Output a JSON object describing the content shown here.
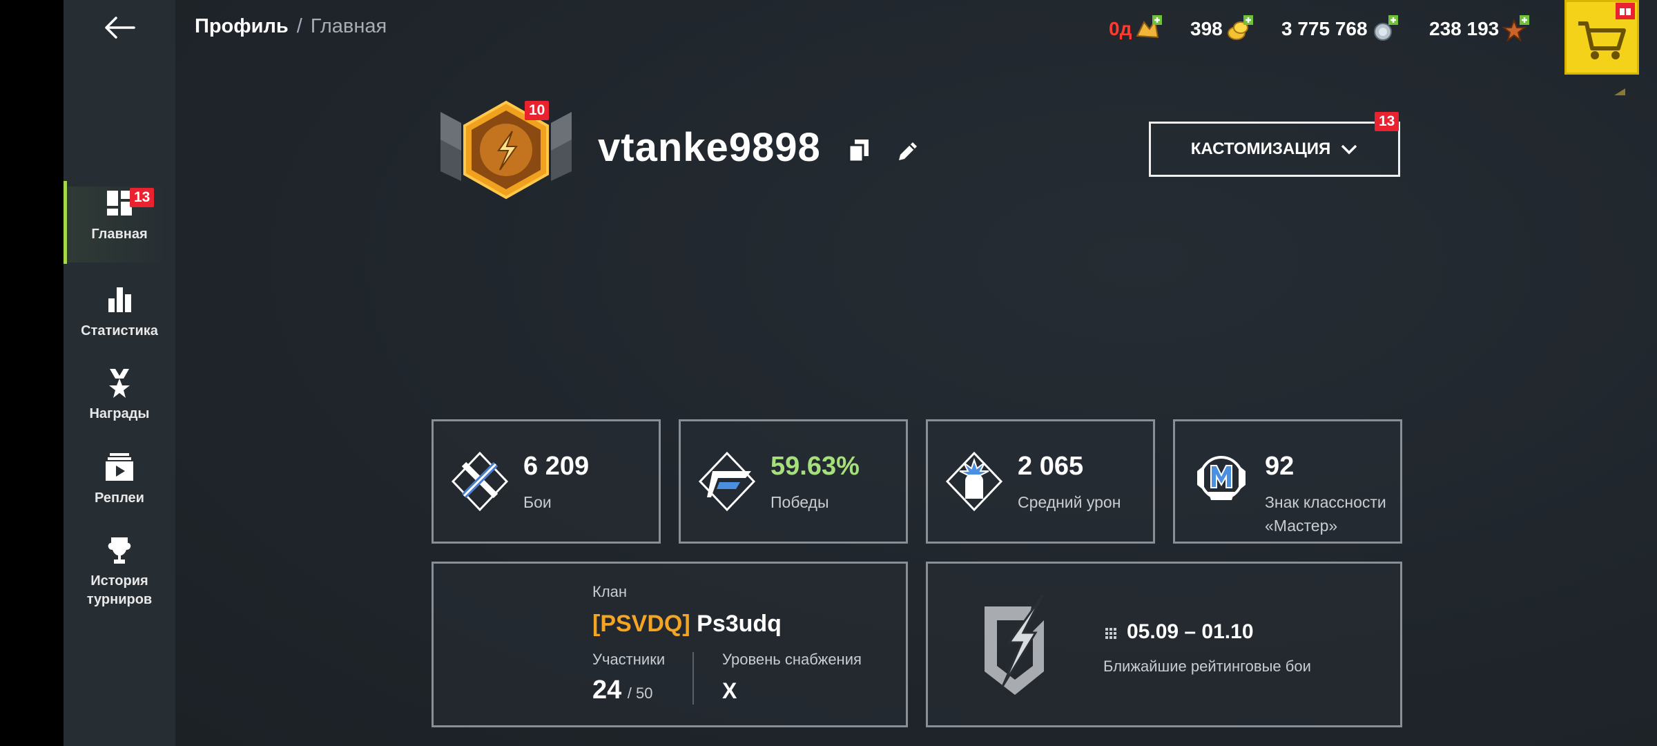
{
  "header": {
    "breadcrumb_primary": "Профиль",
    "breadcrumb_separator": "/",
    "breadcrumb_secondary": "Главная"
  },
  "currencies": [
    {
      "value": "0д",
      "icon": "premium-icon",
      "color": "#ff3b30"
    },
    {
      "value": "398",
      "icon": "gold-icon",
      "color": "#ffffff"
    },
    {
      "value": "3 775 768",
      "icon": "credits-icon",
      "color": "#ffffff"
    },
    {
      "value": "238 193",
      "icon": "free-xp-icon",
      "color": "#ffffff"
    }
  ],
  "sidebar": {
    "items": [
      {
        "label": "Главная",
        "icon": "dashboard-icon",
        "badge": "13",
        "active": true
      },
      {
        "label": "Статистика",
        "icon": "stats-icon"
      },
      {
        "label": "Награды",
        "icon": "awards-icon"
      },
      {
        "label": "Реплеи",
        "icon": "replays-icon"
      },
      {
        "label": "История турниров",
        "icon": "trophy-icon"
      }
    ]
  },
  "profile": {
    "username": "vtanke9898",
    "level_badge": "10",
    "customize_label": "КАСТОМИЗАЦИЯ",
    "customize_badge": "13"
  },
  "stats": [
    {
      "value": "6 209",
      "label": "Бои",
      "icon": "battles-icon"
    },
    {
      "value": "59.63%",
      "label": "Победы",
      "icon": "victories-icon",
      "value_color": "#a6e07a"
    },
    {
      "value": "2 065",
      "label": "Средний урон",
      "icon": "damage-icon"
    },
    {
      "value": "92",
      "label": "Знак классности «Мастер»",
      "icon": "mastery-icon"
    }
  ],
  "clan": {
    "title": "Клан",
    "tag": "[PSVDQ]",
    "name": "Ps3udq",
    "members_label": "Участники",
    "members_count": "24",
    "members_max": "/ 50",
    "supply_label": "Уровень снабжения",
    "supply_value": "X"
  },
  "rating": {
    "dates": "05.09 – 01.10",
    "label": "Ближайшие рейтинговые бои"
  },
  "colors": {
    "accent_green": "#a6d84a",
    "badge_red": "#e8222f",
    "clan_tag": "#f5a524",
    "shop_yellow": "#f5d21a"
  }
}
